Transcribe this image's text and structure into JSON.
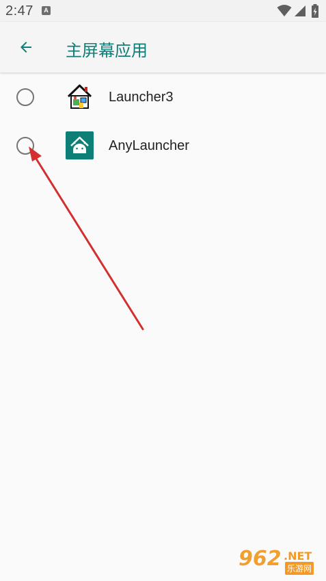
{
  "status_bar": {
    "time": "2:47",
    "notification_badge": "A",
    "icons": [
      "wifi-icon",
      "signal-icon",
      "battery-charging-icon"
    ]
  },
  "app_bar": {
    "back_icon": "arrow-back-icon",
    "title": "主屏幕应用",
    "accent_color": "#0d7f76"
  },
  "launchers": [
    {
      "label": "Launcher3",
      "icon": "launcher3-house-icon",
      "selected": false
    },
    {
      "label": "AnyLauncher",
      "icon": "anylauncher-android-icon",
      "selected": false
    }
  ],
  "annotation": {
    "type": "red-arrow",
    "color": "#d32f2f",
    "points_to": "anylauncher-radio"
  },
  "watermark": {
    "number": "962",
    "suffix": ".NET",
    "chinese": "乐游网"
  }
}
